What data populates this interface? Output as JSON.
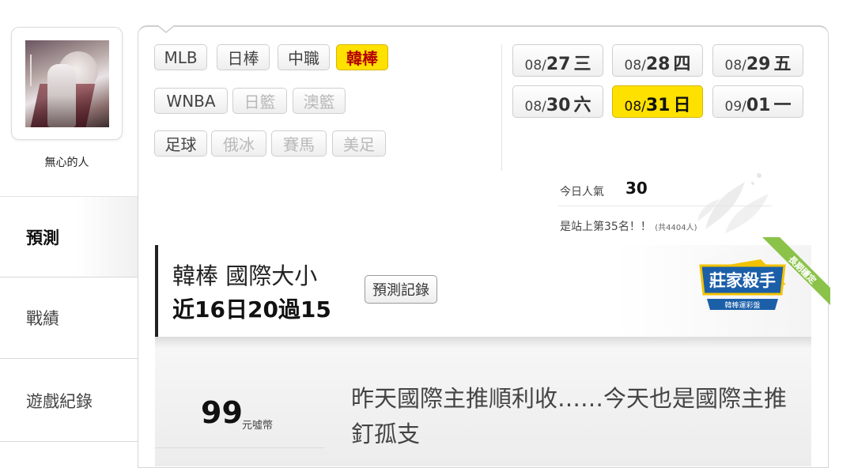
{
  "profile": {
    "username": "無心的人"
  },
  "sidebar": {
    "tabs": [
      {
        "label": "預測",
        "active": true
      },
      {
        "label": "戰績",
        "active": false
      },
      {
        "label": "遊戲紀錄",
        "active": false
      }
    ]
  },
  "sports": [
    {
      "label": "MLB",
      "state": "normal"
    },
    {
      "label": "日棒",
      "state": "normal"
    },
    {
      "label": "中職",
      "state": "normal"
    },
    {
      "label": "韓棒",
      "state": "active"
    },
    {
      "label": "WNBA",
      "state": "normal"
    },
    {
      "label": "日籃",
      "state": "disabled"
    },
    {
      "label": "澳籃",
      "state": "disabled"
    },
    {
      "label": "足球",
      "state": "normal"
    },
    {
      "label": "俄冰",
      "state": "disabled"
    },
    {
      "label": "賽馬",
      "state": "disabled"
    },
    {
      "label": "美足",
      "state": "disabled"
    }
  ],
  "dates": [
    {
      "md": "08/",
      "dd": "27",
      "wd": "三",
      "active": false
    },
    {
      "md": "08/",
      "dd": "28",
      "wd": "四",
      "active": false
    },
    {
      "md": "08/",
      "dd": "29",
      "wd": "五",
      "active": false
    },
    {
      "md": "08/",
      "dd": "30",
      "wd": "六",
      "active": false
    },
    {
      "md": "08/",
      "dd": "31",
      "wd": "日",
      "active": true
    },
    {
      "md": "09/",
      "dd": "01",
      "wd": "一",
      "active": false
    }
  ],
  "popularity": {
    "label": "今日人氣",
    "value": "30",
    "rank_text": "是站上第35名！！",
    "rank_total": "(共4404人)"
  },
  "prediction": {
    "title": "韓棒 國際大小",
    "record": "近16日20過15",
    "record_button": "預測記錄",
    "badge_title": "莊家殺手",
    "badge_sub": "韓棒運彩盤",
    "badge_ribbon": "長期穩定"
  },
  "post": {
    "price": "99",
    "price_unit": "元噓幣",
    "text": "昨天國際主推順利收……今天也是國際主推釘孤支"
  },
  "colors": {
    "active_yellow": "#ffe100",
    "active_text_red": "#b30000",
    "badge_blue": "#1b5fa8",
    "badge_gold": "#f2c200"
  }
}
